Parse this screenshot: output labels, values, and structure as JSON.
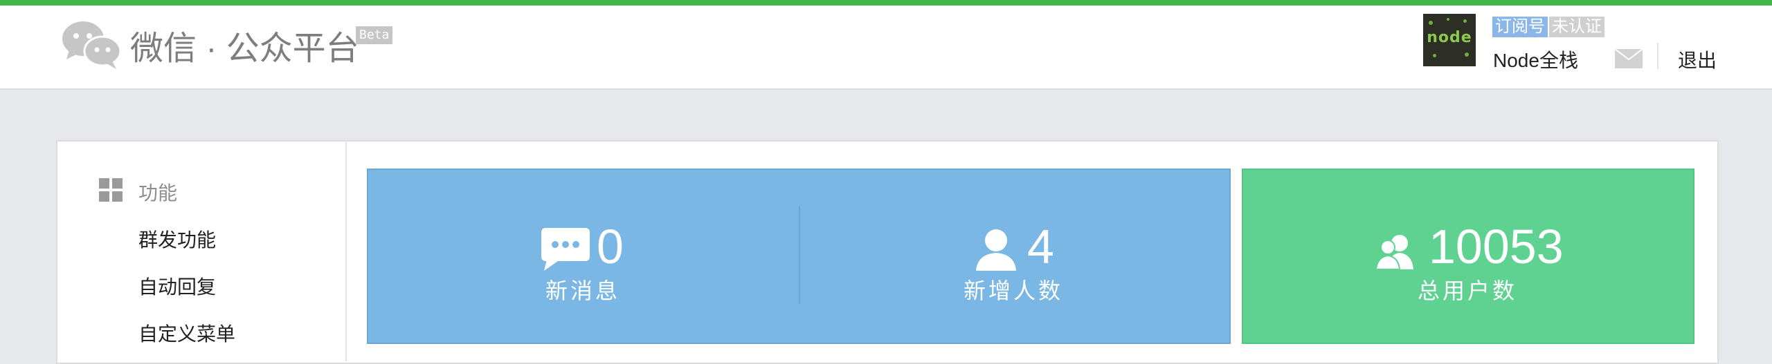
{
  "header": {
    "brand": "微信 · 公众平台",
    "beta": "Beta",
    "account_type_badge": "订阅号",
    "verification_badge": "未认证",
    "account_name": "Node全栈",
    "avatar_text": "node",
    "logout_label": "退出"
  },
  "sidebar": {
    "section_title": "功能",
    "items": [
      {
        "label": "群发功能"
      },
      {
        "label": "自动回复"
      },
      {
        "label": "自定义菜单"
      }
    ]
  },
  "stats": [
    {
      "value": "0",
      "label": "新消息",
      "icon": "message-icon"
    },
    {
      "value": "4",
      "label": "新增人数",
      "icon": "user-icon"
    },
    {
      "value": "10053",
      "label": "总用户数",
      "icon": "users-icon"
    }
  ],
  "colors": {
    "top_bar": "#44b549",
    "stats_blue": "#7ab7e4",
    "stats_green": "#5fd292"
  }
}
